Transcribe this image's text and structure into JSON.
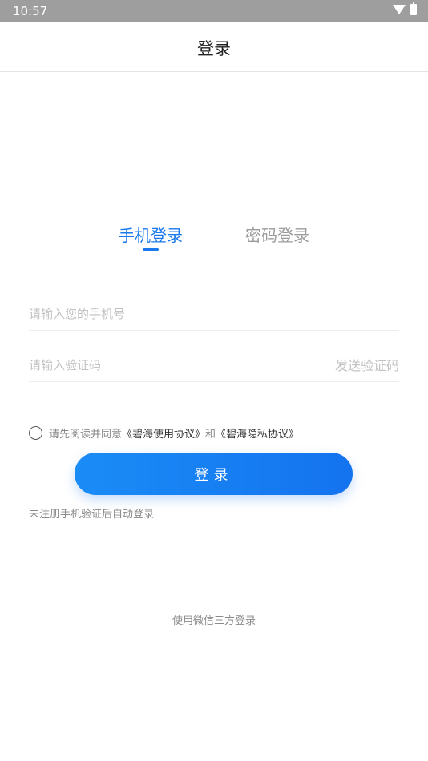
{
  "status_bar": {
    "time": "10:57"
  },
  "header": {
    "title": "登录"
  },
  "tabs": [
    {
      "label": "手机登录",
      "active": true
    },
    {
      "label": "密码登录",
      "active": false
    }
  ],
  "form": {
    "phone_placeholder": "请输入您的手机号",
    "code_placeholder": "请输入验证码",
    "send_code_label": "发送验证码"
  },
  "agreement": {
    "prefix": "请先阅读并同意",
    "terms_link": "《碧海使用协议》",
    "conjunction": "和",
    "privacy_link": "《碧海隐私协议》",
    "checked": false
  },
  "login_button_label": "登录",
  "auto_register_note": "未注册手机验证后自动登录",
  "wechat_login_label": "使用微信三方登录",
  "colors": {
    "accent": "#1a78ee",
    "inactive": "#9b9b9b"
  },
  "icons": [
    "wifi-icon",
    "battery-icon"
  ]
}
